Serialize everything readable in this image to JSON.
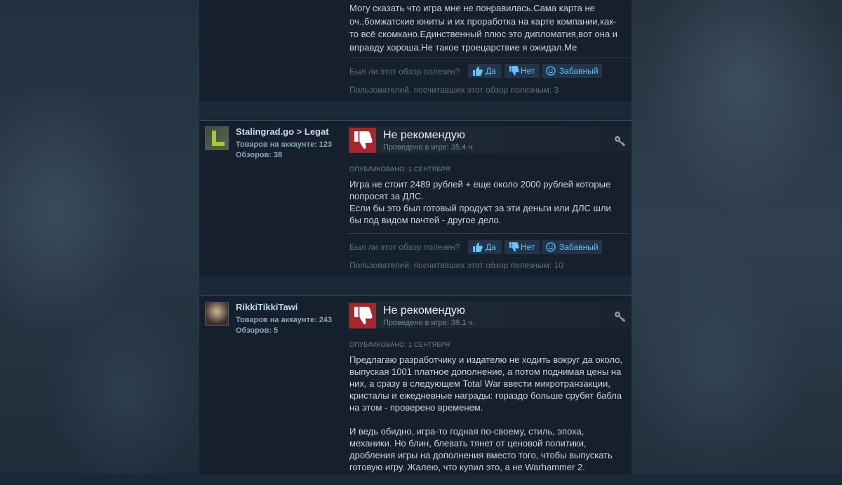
{
  "helpful_question": "Был ли этот обзор полезен?",
  "vote_labels": {
    "yes": "Да",
    "no": "Нет",
    "funny": "Забавный"
  },
  "reviews": [
    {
      "text_lines": "Могу сказать что игра мне не понравилась.Сама карта не оч.,бомжатские юниты и их проработка на карте компании,как-то всё скомкано.Единственный плюс это дипломатия,вот она и вправду хороша.Не такое троецарствие я ожидал.Ме",
      "helpful_count": "Пользователей, посчитавших этот обзор полезным: 3"
    },
    {
      "author": "Stalingrad.go > Legat",
      "products": "Товаров на аккаунте: 123",
      "reviews": "Обзоров: 38",
      "verdict": "Не рекомендую",
      "hours": "Проведено в игре: 35.4 ч.",
      "posted": "ОПУБЛИКОВАНО: 1 СЕНТЯБРЯ",
      "text": "Игра не стоит 2489 рублей + еще около 2000 рублей которые попросят за ДЛС.",
      "text2": "Если бы это был готовый продукт за эти деньги или ДЛС шли бы под видом пачтей - другое дело.",
      "helpful_count": "Пользователей, посчитавших этот обзор полезным: 10"
    },
    {
      "author": "RikkiTikkiTawi",
      "products": "Товаров на аккаунте: 243",
      "reviews": "Обзоров: 5",
      "verdict": "Не рекомендую",
      "hours": "Проведено в игре: 39.1 ч.",
      "posted": "ОПУБЛИКОВАНО: 1 СЕНТЯБРЯ",
      "para1": "Предлагаю разработчику и издателю не ходить вокруг да около, выпуская 1001 платное дополнение, а потом поднимая цены на них, а сразу в следующем Total War ввести микротранзакции, кристалы и ежедневные награды: гораздо больше срубят бабла на этом - проверено временем.",
      "para2": "И ведь обидно, игра-то годная по-своему, стиль, эпоха, механики. Но блин, блевать тянет от ценовой политики, дробления игры на дополнения вместо того, чтобы выпускать готовую игру. Жалею, что купил это, а не Warhammer 2."
    }
  ],
  "icons": [
    "thumbs-down-icon",
    "thumbs-up-icon",
    "key-icon",
    "smiley-icon"
  ],
  "colors": {
    "thumb_bg": "#a3282b",
    "link": "#67c1f5",
    "panel": "#16202d"
  }
}
